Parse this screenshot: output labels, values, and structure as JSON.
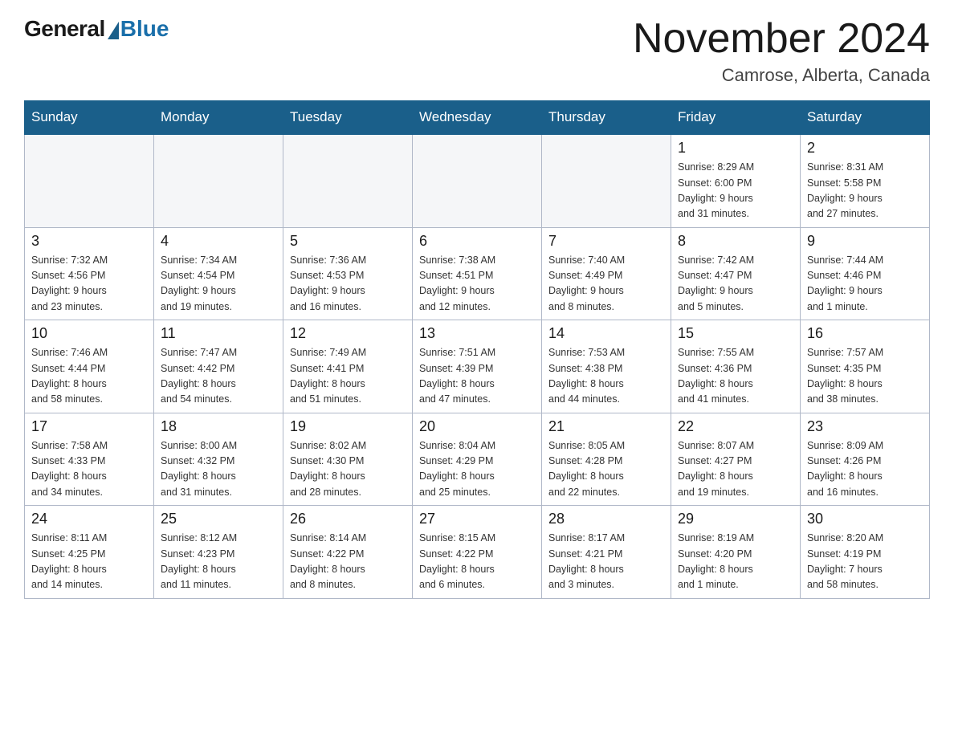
{
  "logo": {
    "general": "General",
    "blue": "Blue"
  },
  "header": {
    "month": "November 2024",
    "location": "Camrose, Alberta, Canada"
  },
  "weekdays": [
    "Sunday",
    "Monday",
    "Tuesday",
    "Wednesday",
    "Thursday",
    "Friday",
    "Saturday"
  ],
  "weeks": [
    [
      {
        "day": "",
        "info": ""
      },
      {
        "day": "",
        "info": ""
      },
      {
        "day": "",
        "info": ""
      },
      {
        "day": "",
        "info": ""
      },
      {
        "day": "",
        "info": ""
      },
      {
        "day": "1",
        "info": "Sunrise: 8:29 AM\nSunset: 6:00 PM\nDaylight: 9 hours\nand 31 minutes."
      },
      {
        "day": "2",
        "info": "Sunrise: 8:31 AM\nSunset: 5:58 PM\nDaylight: 9 hours\nand 27 minutes."
      }
    ],
    [
      {
        "day": "3",
        "info": "Sunrise: 7:32 AM\nSunset: 4:56 PM\nDaylight: 9 hours\nand 23 minutes."
      },
      {
        "day": "4",
        "info": "Sunrise: 7:34 AM\nSunset: 4:54 PM\nDaylight: 9 hours\nand 19 minutes."
      },
      {
        "day": "5",
        "info": "Sunrise: 7:36 AM\nSunset: 4:53 PM\nDaylight: 9 hours\nand 16 minutes."
      },
      {
        "day": "6",
        "info": "Sunrise: 7:38 AM\nSunset: 4:51 PM\nDaylight: 9 hours\nand 12 minutes."
      },
      {
        "day": "7",
        "info": "Sunrise: 7:40 AM\nSunset: 4:49 PM\nDaylight: 9 hours\nand 8 minutes."
      },
      {
        "day": "8",
        "info": "Sunrise: 7:42 AM\nSunset: 4:47 PM\nDaylight: 9 hours\nand 5 minutes."
      },
      {
        "day": "9",
        "info": "Sunrise: 7:44 AM\nSunset: 4:46 PM\nDaylight: 9 hours\nand 1 minute."
      }
    ],
    [
      {
        "day": "10",
        "info": "Sunrise: 7:46 AM\nSunset: 4:44 PM\nDaylight: 8 hours\nand 58 minutes."
      },
      {
        "day": "11",
        "info": "Sunrise: 7:47 AM\nSunset: 4:42 PM\nDaylight: 8 hours\nand 54 minutes."
      },
      {
        "day": "12",
        "info": "Sunrise: 7:49 AM\nSunset: 4:41 PM\nDaylight: 8 hours\nand 51 minutes."
      },
      {
        "day": "13",
        "info": "Sunrise: 7:51 AM\nSunset: 4:39 PM\nDaylight: 8 hours\nand 47 minutes."
      },
      {
        "day": "14",
        "info": "Sunrise: 7:53 AM\nSunset: 4:38 PM\nDaylight: 8 hours\nand 44 minutes."
      },
      {
        "day": "15",
        "info": "Sunrise: 7:55 AM\nSunset: 4:36 PM\nDaylight: 8 hours\nand 41 minutes."
      },
      {
        "day": "16",
        "info": "Sunrise: 7:57 AM\nSunset: 4:35 PM\nDaylight: 8 hours\nand 38 minutes."
      }
    ],
    [
      {
        "day": "17",
        "info": "Sunrise: 7:58 AM\nSunset: 4:33 PM\nDaylight: 8 hours\nand 34 minutes."
      },
      {
        "day": "18",
        "info": "Sunrise: 8:00 AM\nSunset: 4:32 PM\nDaylight: 8 hours\nand 31 minutes."
      },
      {
        "day": "19",
        "info": "Sunrise: 8:02 AM\nSunset: 4:30 PM\nDaylight: 8 hours\nand 28 minutes."
      },
      {
        "day": "20",
        "info": "Sunrise: 8:04 AM\nSunset: 4:29 PM\nDaylight: 8 hours\nand 25 minutes."
      },
      {
        "day": "21",
        "info": "Sunrise: 8:05 AM\nSunset: 4:28 PM\nDaylight: 8 hours\nand 22 minutes."
      },
      {
        "day": "22",
        "info": "Sunrise: 8:07 AM\nSunset: 4:27 PM\nDaylight: 8 hours\nand 19 minutes."
      },
      {
        "day": "23",
        "info": "Sunrise: 8:09 AM\nSunset: 4:26 PM\nDaylight: 8 hours\nand 16 minutes."
      }
    ],
    [
      {
        "day": "24",
        "info": "Sunrise: 8:11 AM\nSunset: 4:25 PM\nDaylight: 8 hours\nand 14 minutes."
      },
      {
        "day": "25",
        "info": "Sunrise: 8:12 AM\nSunset: 4:23 PM\nDaylight: 8 hours\nand 11 minutes."
      },
      {
        "day": "26",
        "info": "Sunrise: 8:14 AM\nSunset: 4:22 PM\nDaylight: 8 hours\nand 8 minutes."
      },
      {
        "day": "27",
        "info": "Sunrise: 8:15 AM\nSunset: 4:22 PM\nDaylight: 8 hours\nand 6 minutes."
      },
      {
        "day": "28",
        "info": "Sunrise: 8:17 AM\nSunset: 4:21 PM\nDaylight: 8 hours\nand 3 minutes."
      },
      {
        "day": "29",
        "info": "Sunrise: 8:19 AM\nSunset: 4:20 PM\nDaylight: 8 hours\nand 1 minute."
      },
      {
        "day": "30",
        "info": "Sunrise: 8:20 AM\nSunset: 4:19 PM\nDaylight: 7 hours\nand 58 minutes."
      }
    ]
  ]
}
